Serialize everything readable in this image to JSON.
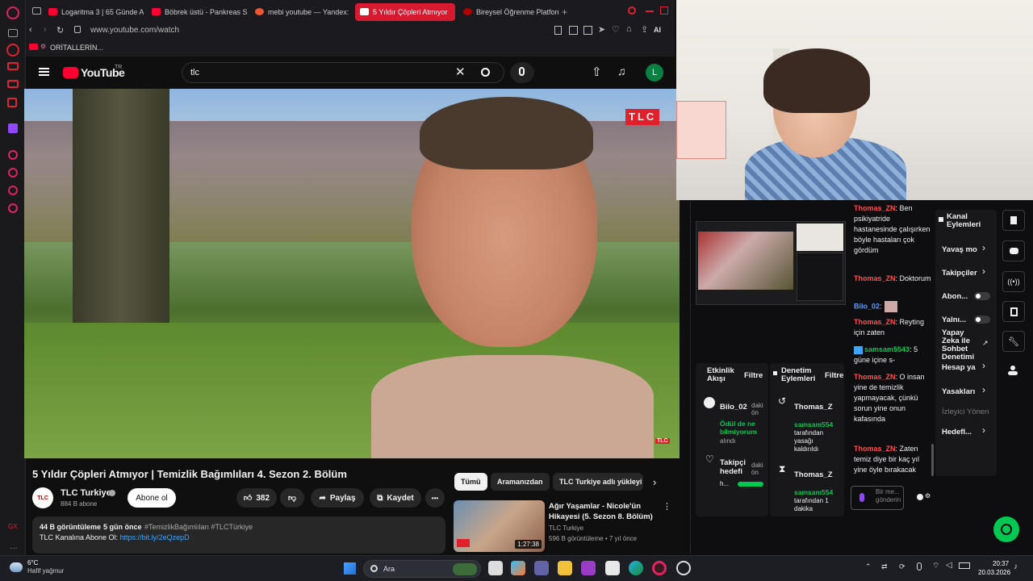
{
  "browser": {
    "tabs": [
      {
        "label": "Logaritma 3 | 65 Günde A"
      },
      {
        "label": "Böbrek üstü - Pankreas S"
      },
      {
        "label": "mebi youtube — Yandex:"
      },
      {
        "label": "5 Yıldır Çöpleri Atmıyor"
      },
      {
        "label": "Bireysel Öğrenme Platform"
      }
    ],
    "url": "www.youtube.com/watch",
    "ai_label": "AI",
    "bookmark": "ORİTALLERİN..."
  },
  "youtube": {
    "logo_text": "YouTube",
    "region": "TR",
    "search_value": "tlc",
    "avatar_letter": "L",
    "video_title": "5 Yıldır Çöpleri Atmıyor | Temizlik Bağımlıları 4. Sezon 2. Bölüm",
    "watermark": "TLC",
    "watermark_small": "TLC",
    "channel": {
      "name": "TLC Turkiye",
      "subs": "884 B abone",
      "avatar_text": "TLC",
      "subscribe": "Abone ol"
    },
    "actions": {
      "likes": "382",
      "share": "Paylaş",
      "save": "Kaydet",
      "more": "•••"
    },
    "description": {
      "views": "44 B görüntüleme",
      "time": "5 gün önce",
      "tags": "#TemizlikBağımlıları #TLCTürkiye",
      "line2_prefix": "TLC Kanalına Abone Ol: ",
      "link": "https://bit.ly/2eQzepD"
    },
    "filter_chips": [
      "Tümü",
      "Aramanızdan",
      "TLC Turkiye adlı yükleyi"
    ],
    "recommended": {
      "title": "Ağır Yaşamlar - Nicole'ün Hikayesi (5. Sezon 8. Bölüm)",
      "channel": "TLC Turkiye",
      "meta": "596 B görüntüleme • 7 yıl önce",
      "duration": "1:27:38"
    }
  },
  "twitch": {
    "chat": [
      {
        "user": "Thomas_ZN",
        "text": ": Ben psikiyatride hastanesinde çalışırken böyle hastaları çok gördüm"
      },
      {
        "user": "Thomas_ZN",
        "text": ": Doktorum"
      },
      {
        "user": "Bilo_02",
        "text": ":"
      },
      {
        "user": "Thomas_ZN",
        "text": ": Reyting için zaten"
      },
      {
        "user": "samsam5543",
        "text": ": 5 güne içine s-"
      },
      {
        "user": "Thomas_ZN",
        "text": ": O insan yine de temizlik yapmayacak, çünkü sorun yine onun kafasında"
      },
      {
        "user": "Thomas_ZN",
        "text": ": Zaten temiz diye bir kaç yıl yine öyle bırakacak"
      }
    ],
    "chat_input_placeholder": "Bir me... gönderin",
    "activity": {
      "title": "Etkinlik Akışı",
      "filter": "Filtre",
      "item1_user": "Bilo_02",
      "item1_ago": "daki ön",
      "item1_reward": "Ödül de ne bilmiyorum",
      "item1_status": "alındı",
      "item2_title": "Takipçi hedefi",
      "item2_ago": "daki ön",
      "item2_prefix": "h..."
    },
    "moderation": {
      "title": "Denetim Eylemleri",
      "filter": "Filtre",
      "item1_user": "Thomas_Z",
      "item1_actor": "samsam554",
      "item1_text": "tarafından yasağı kaldırıldı",
      "item2_user": "Thomas_Z",
      "item2_actor": "samsam554",
      "item2_text": "tarafından 1 dakika"
    },
    "channel_actions": {
      "title": "Kanal Eylemleri",
      "items": [
        "Yavaş mo",
        "Takipçiler",
        "Abon...",
        "Yalnı...",
        "Yapay Zeka ile Sohbet Denetimi",
        "Hesap ya",
        "Yasakları",
        "İzleyici Yönen",
        "Hedefl..."
      ]
    }
  },
  "taskbar": {
    "weather_temp": "6°C",
    "weather_desc": "Hafif yağmur",
    "search": "Ara",
    "time": "20:37",
    "date": "20.03.2026"
  },
  "colors": {
    "accent_red": "#ff0033",
    "twitch_purple": "#9147ff",
    "green": "#00c853"
  }
}
